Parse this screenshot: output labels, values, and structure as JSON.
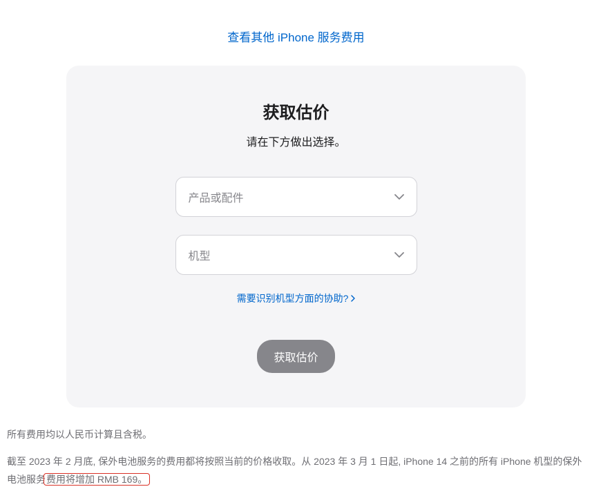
{
  "topLink": "查看其他 iPhone 服务费用",
  "card": {
    "title": "获取估价",
    "subtitle": "请在下方做出选择。",
    "select1Placeholder": "产品或配件",
    "select2Placeholder": "机型",
    "helpText": "需要识别机型方面的协助?",
    "buttonLabel": "获取估价"
  },
  "footnote1": "所有费用均以人民币计算且含税。",
  "footnote2a": "截至 2023 年 2 月底, 保外电池服务的费用都将按照当前的价格收取。从 2023 年 3 月 1 日起, iPhone 14 之前的所有 iPhone 机型的保外电池服务",
  "footnote2b": "费用将增加 RMB 169。"
}
